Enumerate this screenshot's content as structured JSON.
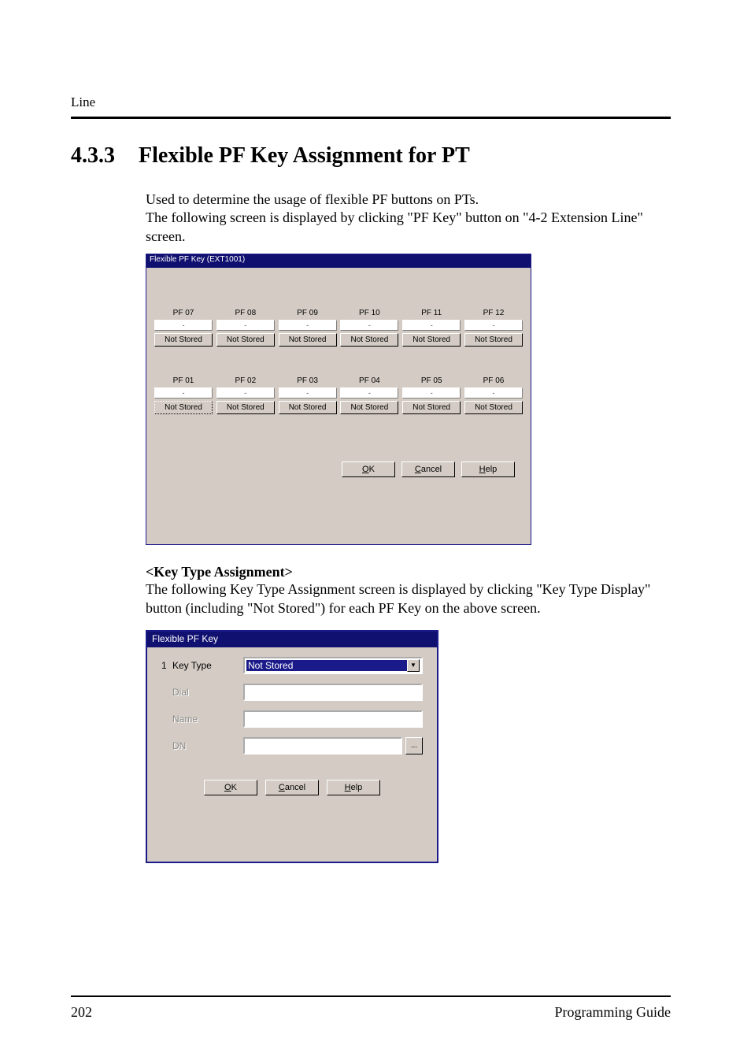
{
  "header": {
    "running": "Line"
  },
  "section": {
    "number": "4.3.3",
    "title": "Flexible PF Key Assignment for PT"
  },
  "intro": {
    "line1": "Used to determine the usage of flexible PF buttons on PTs.",
    "line2": "The following screen is displayed by clicking \"PF Key\" button on \"4-2 Extension Line\" screen."
  },
  "dlg1": {
    "title": "Flexible PF Key (EXT1001)",
    "row_top": [
      {
        "label": "PF 07",
        "dash": "-",
        "btn": "Not Stored"
      },
      {
        "label": "PF 08",
        "dash": "-",
        "btn": "Not Stored"
      },
      {
        "label": "PF 09",
        "dash": "-",
        "btn": "Not Stored"
      },
      {
        "label": "PF 10",
        "dash": "-",
        "btn": "Not Stored"
      },
      {
        "label": "PF 11",
        "dash": "-",
        "btn": "Not Stored"
      },
      {
        "label": "PF 12",
        "dash": "-",
        "btn": "Not Stored"
      }
    ],
    "row_bot": [
      {
        "label": "PF 01",
        "dash": "-",
        "btn": "Not Stored"
      },
      {
        "label": "PF 02",
        "dash": "-",
        "btn": "Not Stored"
      },
      {
        "label": "PF 03",
        "dash": "-",
        "btn": "Not Stored"
      },
      {
        "label": "PF 04",
        "dash": "-",
        "btn": "Not Stored"
      },
      {
        "label": "PF 05",
        "dash": "-",
        "btn": "Not Stored"
      },
      {
        "label": "PF 06",
        "dash": "-",
        "btn": "Not Stored"
      }
    ],
    "buttons": {
      "ok_u": "O",
      "ok_rest": "K",
      "cancel_u": "C",
      "cancel_rest": "ancel",
      "help_u": "H",
      "help_rest": "elp"
    }
  },
  "kta": {
    "heading": "<Key Type Assignment>",
    "line1": "The following Key Type Assignment screen is displayed by clicking \"Key Type Display\"",
    "line2": "button (including \"Not Stored\") for each PF Key on the above screen."
  },
  "dlg2": {
    "title": "Flexible PF Key",
    "rownum": "1",
    "keytype_label": "Key Type",
    "keytype_value": "Not Stored",
    "dial_label": "Dial",
    "name_label": "Name",
    "dn_label": "DN",
    "dn_btn": "...",
    "buttons": {
      "ok_u": "O",
      "ok_rest": "K",
      "cancel_u": "C",
      "cancel_rest": "ancel",
      "help_u": "H",
      "help_rest": "elp"
    }
  },
  "footer": {
    "page": "202",
    "doc": "Programming Guide"
  }
}
